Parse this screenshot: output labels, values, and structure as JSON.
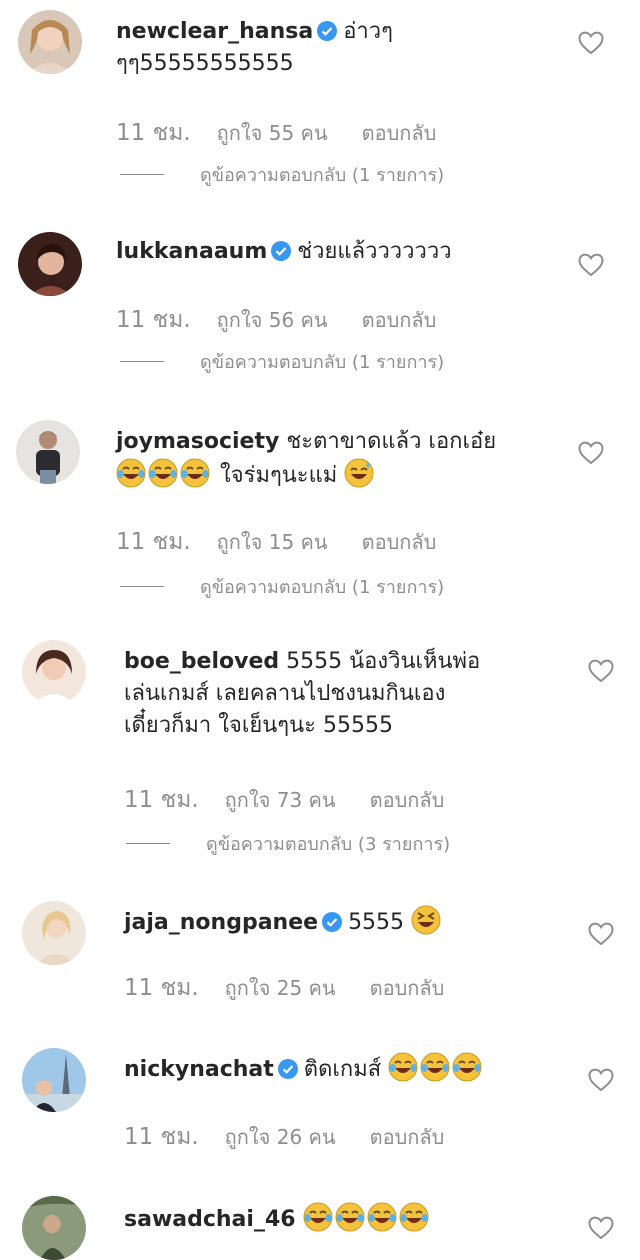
{
  "comments": [
    {
      "username": "newclear_hansa",
      "verified": true,
      "lines": [
        "อ่าวๆ",
        "ๆๆ55555555555"
      ],
      "time": "11 ชม.",
      "likes": "ถูกใจ 55 คน",
      "reply": "ตอบกลับ",
      "view_replies": "ดูข้อความตอบกลับ (1 รายการ)"
    },
    {
      "username": "lukkanaaum",
      "verified": true,
      "lines": [
        "ช่วยแล้ววววววว"
      ],
      "time": "11 ชม.",
      "likes": "ถูกใจ 56 คน",
      "reply": "ตอบกลับ",
      "view_replies": "ดูข้อความตอบกลับ (1 รายการ)"
    },
    {
      "username": "joymasociety",
      "verified": false,
      "lines": [
        "ชะตาขาดแล้ว เอกเอ๋ย",
        "ใจร่มๆนะแม่"
      ],
      "time": "11 ชม.",
      "likes": "ถูกใจ 15 คน",
      "reply": "ตอบกลับ",
      "view_replies": "ดูข้อความตอบกลับ (1 รายการ)"
    },
    {
      "username": "boe_beloved",
      "verified": false,
      "lines": [
        "5555 น้องวินเห็นพ่อ",
        "เล่นเกมส์ เลยคลานไปชงนมกินเอง",
        "เดี๋ยวก็มา ใจเย็นๆนะ 55555"
      ],
      "time": "11 ชม.",
      "likes": "ถูกใจ 73 คน",
      "reply": "ตอบกลับ",
      "view_replies": "ดูข้อความตอบกลับ (3 รายการ)"
    },
    {
      "username": "jaja_nongpanee",
      "verified": true,
      "lines": [
        "5555"
      ],
      "time": "11 ชม.",
      "likes": "ถูกใจ 25 คน",
      "reply": "ตอบกลับ"
    },
    {
      "username": "nickynachat",
      "verified": true,
      "lines": [
        "ติดเกมส์"
      ],
      "time": "11 ชม.",
      "likes": "ถูกใจ 26 คน",
      "reply": "ตอบกลับ"
    },
    {
      "username": "sawadchai_46",
      "verified": false,
      "lines": [
        ""
      ]
    }
  ],
  "icons": {
    "verified": "verified-badge-icon",
    "like": "heart-outline-icon",
    "emoji_laugh": "face-with-tears-of-joy",
    "emoji_sweat": "grinning-face-with-sweat",
    "emoji_squint": "grinning-squinting-face"
  },
  "colors": {
    "text": "#262626",
    "muted": "#8e8e8e",
    "verified": "#3897f0",
    "emoji": "#f5c33b"
  }
}
